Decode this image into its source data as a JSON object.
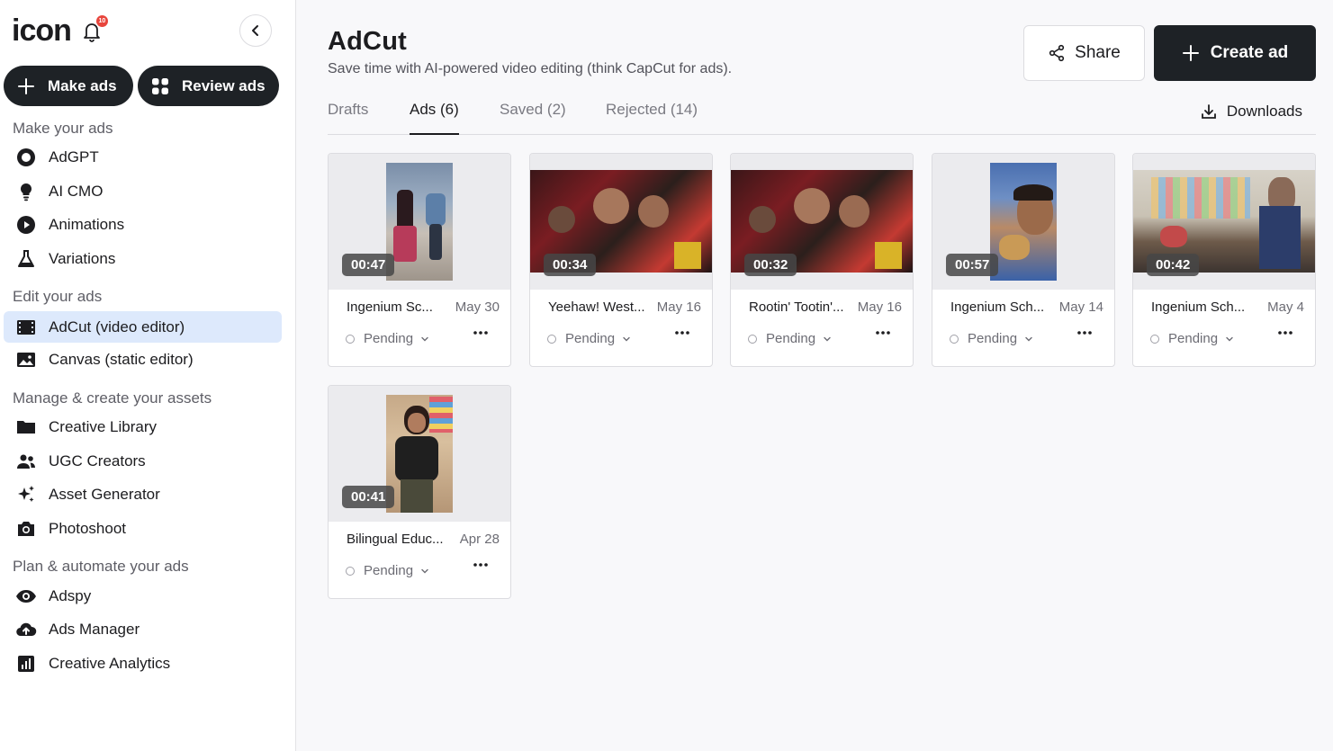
{
  "app": {
    "logo_text": "icon",
    "notification_count": "10"
  },
  "sidebar": {
    "make_ads_label": "Make ads",
    "review_ads_label": "Review ads",
    "sections": [
      {
        "title": "Make your ads",
        "items": [
          {
            "label": "AdGPT",
            "icon": "adgpt-circle-icon"
          },
          {
            "label": "AI CMO",
            "icon": "lightbulb-icon"
          },
          {
            "label": "Animations",
            "icon": "play-circle-icon"
          },
          {
            "label": "Variations",
            "icon": "flask-icon"
          }
        ]
      },
      {
        "title": "Edit your ads",
        "items": [
          {
            "label": "AdCut (video editor)",
            "icon": "film-icon",
            "active": true
          },
          {
            "label": "Canvas (static editor)",
            "icon": "image-icon"
          }
        ]
      },
      {
        "title": "Manage & create your assets",
        "items": [
          {
            "label": "Creative Library",
            "icon": "folder-icon"
          },
          {
            "label": "UGC Creators",
            "icon": "users-icon"
          },
          {
            "label": "Asset Generator",
            "icon": "sparkles-icon"
          },
          {
            "label": "Photoshoot",
            "icon": "camera-icon"
          }
        ]
      },
      {
        "title": "Plan & automate your ads",
        "items": [
          {
            "label": "Adspy",
            "icon": "eye-icon"
          },
          {
            "label": "Ads Manager",
            "icon": "cloud-upload-icon"
          },
          {
            "label": "Creative Analytics",
            "icon": "bar-chart-icon"
          }
        ]
      }
    ]
  },
  "header": {
    "title": "AdCut",
    "subtitle": "Save time with AI-powered video editing (think CapCut for ads).",
    "share_label": "Share",
    "create_label": "Create ad"
  },
  "tabs": [
    {
      "label": "Drafts",
      "active": false
    },
    {
      "label": "Ads (6)",
      "active": true
    },
    {
      "label": "Saved (2)",
      "active": false
    },
    {
      "label": "Rejected (14)",
      "active": false
    }
  ],
  "downloads_label": "Downloads",
  "ads": [
    {
      "title": "Ingenium Sc...",
      "date": "May 30",
      "duration": "00:47",
      "status": "Pending",
      "orientation": "portrait"
    },
    {
      "title": "Yeehaw! West...",
      "date": "May 16",
      "duration": "00:34",
      "status": "Pending",
      "orientation": "landscape"
    },
    {
      "title": "Rootin' Tootin'...",
      "date": "May 16",
      "duration": "00:32",
      "status": "Pending",
      "orientation": "landscape"
    },
    {
      "title": "Ingenium Sch...",
      "date": "May 14",
      "duration": "00:57",
      "status": "Pending",
      "orientation": "portrait"
    },
    {
      "title": "Ingenium Sch...",
      "date": "May 4",
      "duration": "00:42",
      "status": "Pending",
      "orientation": "landscape"
    },
    {
      "title": "Bilingual Educ...",
      "date": "Apr 28",
      "duration": "00:41",
      "status": "Pending",
      "orientation": "portrait"
    }
  ],
  "colors": {
    "dark_button": "#1e2226",
    "active_nav": "#dde9fc",
    "badge": "#e8453c",
    "text_primary": "#1c1c1f",
    "text_muted": "#6c6c74"
  }
}
